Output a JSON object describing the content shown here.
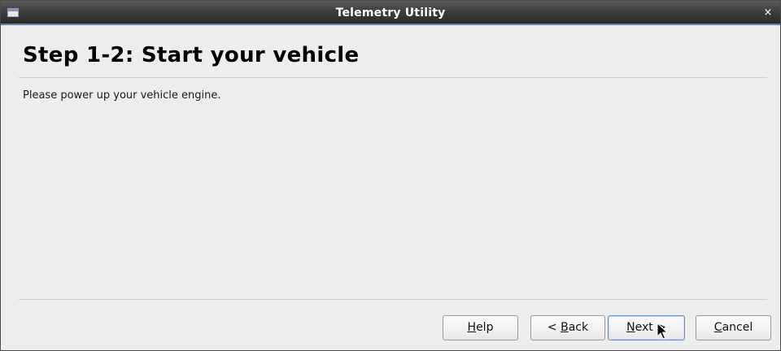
{
  "window": {
    "title": "Telemetry Utility",
    "close_glyph": "×",
    "icon": "window-icon"
  },
  "page": {
    "heading": "Step 1-2: Start your vehicle",
    "instruction": "Please power up your vehicle engine."
  },
  "buttons": {
    "help_mnemonic": "H",
    "help_rest": "elp",
    "back_prefix": "< ",
    "back_mnemonic": "B",
    "back_rest": "ack",
    "next_mnemonic": "N",
    "next_rest": "ext >",
    "cancel_mnemonic": "C",
    "cancel_rest": "ancel"
  },
  "colors": {
    "titlebar": "#3f3f3f",
    "titlebar_accent": "#6b85a8",
    "window_bg": "#ededed"
  }
}
